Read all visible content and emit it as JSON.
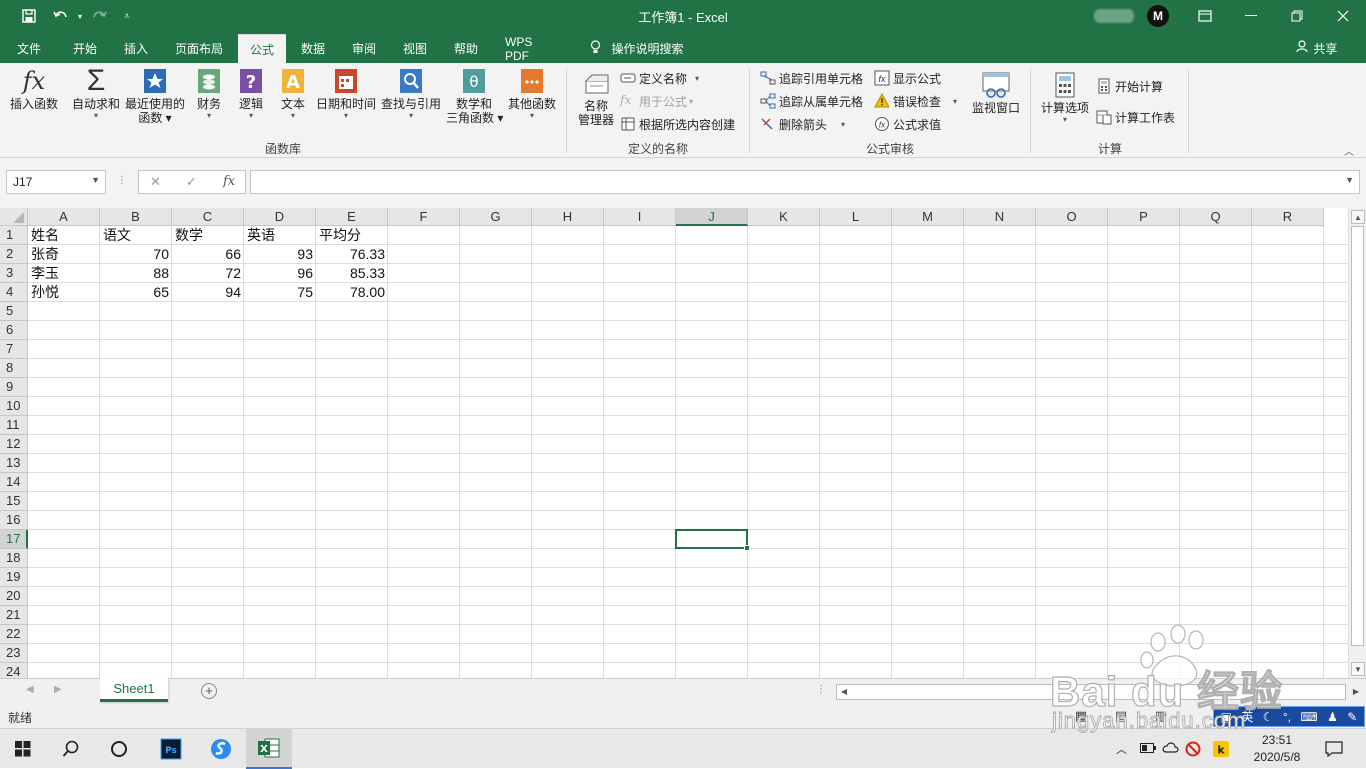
{
  "window": {
    "title": "工作簿1  -  Excel"
  },
  "menu_tabs": [
    {
      "label": "文件"
    },
    {
      "label": "开始"
    },
    {
      "label": "插入"
    },
    {
      "label": "页面布局"
    },
    {
      "label": "公式"
    },
    {
      "label": "数据"
    },
    {
      "label": "审阅"
    },
    {
      "label": "视图"
    },
    {
      "label": "帮助"
    },
    {
      "label": "WPS PDF"
    },
    {
      "label": "操作说明搜索"
    }
  ],
  "share_label": "共享",
  "ribbon": {
    "function_library": {
      "group_label": "函数库",
      "insert_function": "插入函数",
      "autosum": "自动求和",
      "recent_l1": "最近使用的",
      "recent_l2": "函数",
      "financial": "财务",
      "logical": "逻辑",
      "text": "文本",
      "datetime": "日期和时间",
      "lookup": "查找与引用",
      "math_l1": "数学和",
      "math_l2": "三角函数",
      "other": "其他函数"
    },
    "defined_names": {
      "group_label": "定义的名称",
      "name_manager_l1": "名称",
      "name_manager_l2": "管理器",
      "define_name": "定义名称",
      "use_in_formula": "用于公式",
      "create_from_selection": "根据所选内容创建"
    },
    "formula_auditing": {
      "group_label": "公式审核",
      "trace_precedents": "追踪引用单元格",
      "trace_dependents": "追踪从属单元格",
      "remove_arrows": "删除箭头",
      "show_formulas": "显示公式",
      "error_checking": "错误检查",
      "evaluate_formula": "公式求值",
      "watch_window": "监视窗口"
    },
    "calculation": {
      "group_label": "计算",
      "calc_options": "计算选项",
      "calc_now": "开始计算",
      "calc_sheet": "计算工作表"
    }
  },
  "formula_bar": {
    "name_box": "J17",
    "formula": ""
  },
  "grid": {
    "columns": [
      "A",
      "B",
      "C",
      "D",
      "E",
      "F",
      "G",
      "H",
      "I",
      "J",
      "K",
      "L",
      "M",
      "N",
      "O",
      "P",
      "Q",
      "R"
    ],
    "rows": [
      "1",
      "2",
      "3",
      "4",
      "5",
      "6",
      "7",
      "8",
      "9",
      "10",
      "11",
      "12",
      "13",
      "14",
      "15",
      "16",
      "17",
      "18",
      "19",
      "20",
      "21",
      "22",
      "23",
      "24"
    ],
    "selected_col": "J",
    "selected_row": "17",
    "data": [
      [
        "姓名",
        "语文",
        "数学",
        "英语",
        "平均分"
      ],
      [
        "张奇",
        "70",
        "66",
        "93",
        "76.33"
      ],
      [
        "李玉",
        "88",
        "72",
        "96",
        "85.33"
      ],
      [
        "孙悦",
        "65",
        "94",
        "75",
        "78.00"
      ]
    ]
  },
  "sheet_tabs": [
    {
      "label": "Sheet1"
    }
  ],
  "status": {
    "ready": "就绪"
  },
  "ime": {
    "lang": "英"
  },
  "taskbar": {
    "apps": [
      "windows-start",
      "search",
      "cortana",
      "photoshop",
      "sogou-browser",
      "excel"
    ],
    "time": "23:51",
    "date": "2020/5/8"
  },
  "watermark": {
    "brand": "Bai du 经验",
    "url": "jingyan.baidu.com"
  },
  "colors": {
    "excel_green": "#217346",
    "accent_blue": "#3c78d8"
  }
}
